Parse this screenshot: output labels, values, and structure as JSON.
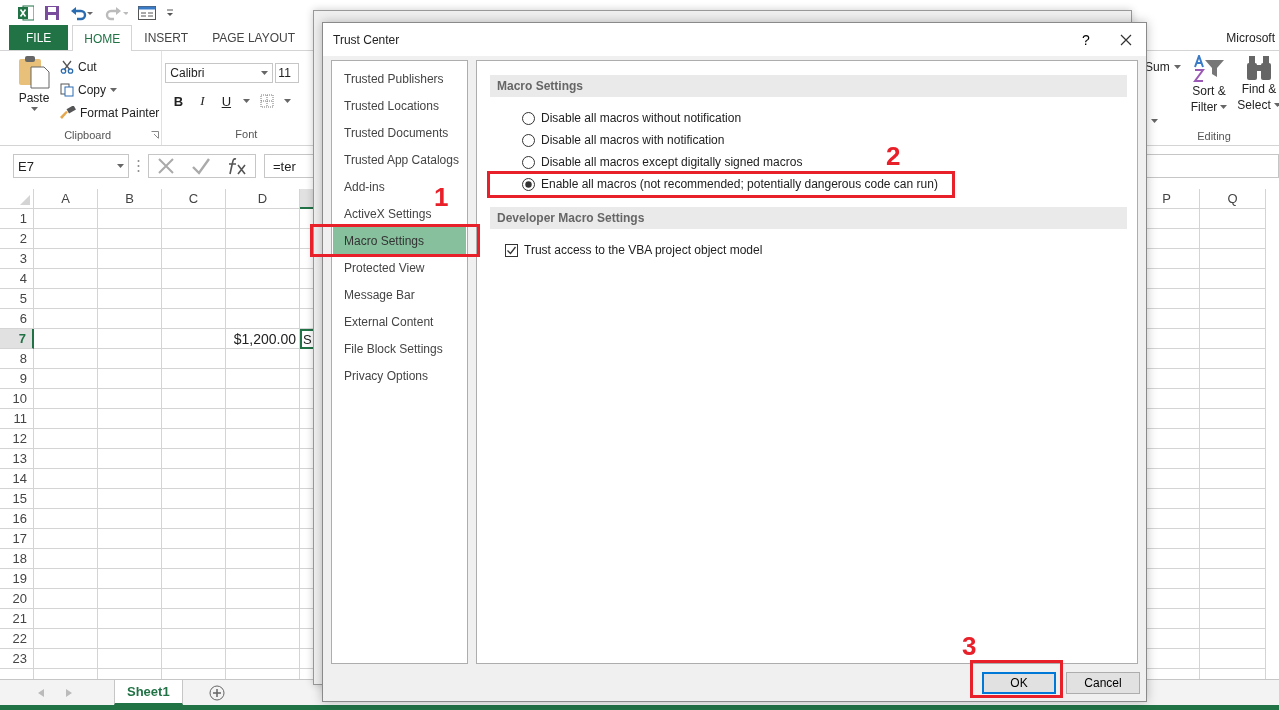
{
  "excel": {
    "ribbon_tabs": [
      {
        "label": "FILE",
        "kind": "file",
        "selected": false
      },
      {
        "label": "HOME",
        "kind": "tab",
        "selected": true
      },
      {
        "label": "INSERT",
        "kind": "tab",
        "selected": false
      },
      {
        "label": "PAGE LAYOUT",
        "kind": "tab",
        "selected": false
      }
    ],
    "account": "Microsoft",
    "clipboard": {
      "paste": "Paste",
      "cut": "Cut",
      "copy": "Copy",
      "format_painter": "Format Painter",
      "label": "Clipboard"
    },
    "font": {
      "name": "Calibri",
      "size": "11",
      "bold": "B",
      "italic": "I",
      "underline": "U",
      "label": "Font"
    },
    "editing": {
      "sum": "Sum",
      "sort": [
        "Sort &",
        "Filter"
      ],
      "find": [
        "Find &",
        "Select"
      ],
      "label": "Editing"
    },
    "name_box": "E7",
    "formula": "=ter",
    "columns": [
      {
        "label": "A",
        "selected": false
      },
      {
        "label": "B",
        "selected": false
      },
      {
        "label": "C",
        "selected": false
      },
      {
        "label": "D",
        "selected": false
      },
      {
        "selected": true
      },
      {
        "label": "P",
        "selected": false
      },
      {
        "label": "Q",
        "selected": false
      }
    ],
    "rows": [
      {
        "label": "1",
        "selected": false
      },
      {
        "label": "2",
        "selected": false
      },
      {
        "label": "3",
        "selected": false
      },
      {
        "label": "4",
        "selected": false
      },
      {
        "label": "5",
        "selected": false
      },
      {
        "label": "6",
        "selected": false
      },
      {
        "label": "7",
        "selected": true,
        "cells": [
          null,
          null,
          null,
          {
            "text": "$1,200.00"
          },
          {
            "text": "S",
            "selected": true
          }
        ]
      },
      {
        "label": "8",
        "selected": false
      },
      {
        "label": "9",
        "selected": false
      },
      {
        "label": "10",
        "selected": false
      },
      {
        "label": "11",
        "selected": false
      },
      {
        "label": "12",
        "selected": false
      },
      {
        "label": "13",
        "selected": false
      },
      {
        "label": "14",
        "selected": false
      },
      {
        "label": "15",
        "selected": false
      },
      {
        "label": "16",
        "selected": false
      },
      {
        "label": "17",
        "selected": false
      },
      {
        "label": "18",
        "selected": false
      },
      {
        "label": "19",
        "selected": false
      },
      {
        "label": "20",
        "selected": false
      },
      {
        "label": "21",
        "selected": false
      },
      {
        "label": "22",
        "selected": false
      },
      {
        "label": "23",
        "selected": false
      }
    ],
    "sheet_tabs": [
      {
        "label": "Sheet1",
        "selected": true
      }
    ]
  },
  "dialog": {
    "title": "Trust Center",
    "help": "?",
    "nav": [
      {
        "label": "Trusted Publishers",
        "selected": false
      },
      {
        "label": "Trusted Locations",
        "selected": false
      },
      {
        "label": "Trusted Documents",
        "selected": false
      },
      {
        "label": "Trusted App Catalogs",
        "selected": false
      },
      {
        "label": "Add-ins",
        "selected": false
      },
      {
        "label": "ActiveX Settings",
        "selected": false
      },
      {
        "label": "Macro Settings",
        "selected": true
      },
      {
        "label": "Protected View",
        "selected": false
      },
      {
        "label": "Message Bar",
        "selected": false
      },
      {
        "label": "External Content",
        "selected": false
      },
      {
        "label": "File Block Settings",
        "selected": false
      },
      {
        "label": "Privacy Options",
        "selected": false
      }
    ],
    "sections": [
      {
        "title": "Macro Settings",
        "options": [
          {
            "kind": "radio",
            "label": "Disable all macros without notification",
            "selected": false
          },
          {
            "kind": "radio",
            "label": "Disable all macros with notification",
            "selected": false
          },
          {
            "kind": "radio",
            "label": "Disable all macros except digitally signed macros",
            "selected": false
          },
          {
            "kind": "radio",
            "label": "Enable all macros (not recommended; potentially dangerous code can run)",
            "selected": true
          }
        ]
      },
      {
        "title": "Developer Macro Settings",
        "options": [
          {
            "kind": "checkbox",
            "label": "Trust access to the VBA project object model",
            "checked": true
          }
        ]
      }
    ],
    "buttons": [
      {
        "label": "OK",
        "default": true
      },
      {
        "label": "Cancel",
        "default": false
      }
    ]
  },
  "annotations": [
    {
      "label": "1"
    },
    {
      "label": "2"
    },
    {
      "label": "3"
    }
  ]
}
